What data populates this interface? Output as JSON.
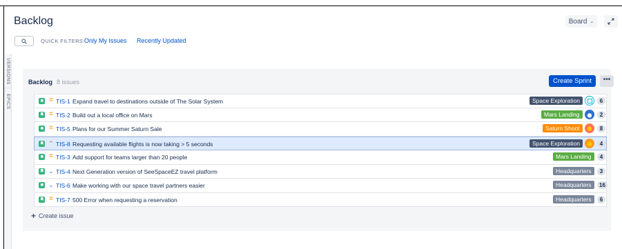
{
  "header": {
    "title": "Backlog",
    "board_label": "Board",
    "board_chevron": "⌄",
    "expand_icon": "expand-icon"
  },
  "filters": {
    "label": "QUICK FILTERS:",
    "items": [
      "Only My Issues",
      "Recently Updated"
    ]
  },
  "side_tabs": [
    "VERSIONS",
    "EPICS"
  ],
  "backlog": {
    "title": "Backlog",
    "count_text": "8 issues",
    "create_sprint_label": "Create Sprint",
    "more_label": "•••",
    "create_issue_label": "Create issue"
  },
  "issues": [
    {
      "key": "TIS-1",
      "summary": "Expand travel to destinations outside of The Solar System",
      "priority": "medium",
      "epic": "Space Exploration",
      "epic_color": "#42526e",
      "avatar": "a1",
      "estimate": "6",
      "selected": false
    },
    {
      "key": "TIS-2",
      "summary": "Build out a local office on Mars",
      "priority": "medium",
      "epic": "Mars Landing",
      "epic_color": "#5aac44",
      "avatar": "a2",
      "estimate": "2",
      "selected": false
    },
    {
      "key": "TIS-5",
      "summary": "Plans for our Summer Saturn Sale",
      "priority": "medium",
      "epic": "Saturn Shoot",
      "epic_color": "#ff8b00",
      "avatar": "a3",
      "estimate": "8",
      "selected": false
    },
    {
      "key": "TIS-8",
      "summary": "Requesting available flights is now taking > 5 seconds",
      "priority": "high",
      "epic": "Space Exploration",
      "epic_color": "#42526e",
      "avatar": "a4",
      "estimate": "4",
      "selected": true
    },
    {
      "key": "TIS-3",
      "summary": "Add support for teams larger than 20 people",
      "priority": "medium",
      "epic": "Mars Landing",
      "epic_color": "#5aac44",
      "avatar": "",
      "estimate": "4",
      "selected": false
    },
    {
      "key": "TIS-4",
      "summary": "Next Generation version of SeeSpaceEZ travel platform",
      "priority": "low",
      "epic": "Headquarters",
      "epic_color": "#7a869a",
      "avatar": "",
      "estimate": "3",
      "selected": false
    },
    {
      "key": "TIS-6",
      "summary": "Make working with our space travel partners easier",
      "priority": "low",
      "epic": "Headquarters",
      "epic_color": "#7a869a",
      "avatar": "",
      "estimate": "16",
      "selected": false
    },
    {
      "key": "TIS-7",
      "summary": "500 Error when requesting a reservation",
      "priority": "medium",
      "epic": "Headquarters",
      "epic_color": "#7a869a",
      "avatar": "",
      "estimate": "6",
      "selected": false
    }
  ],
  "colors": {
    "primary": "#0052cc",
    "selected_row": "#deebff",
    "story_icon": "#36b37e"
  }
}
